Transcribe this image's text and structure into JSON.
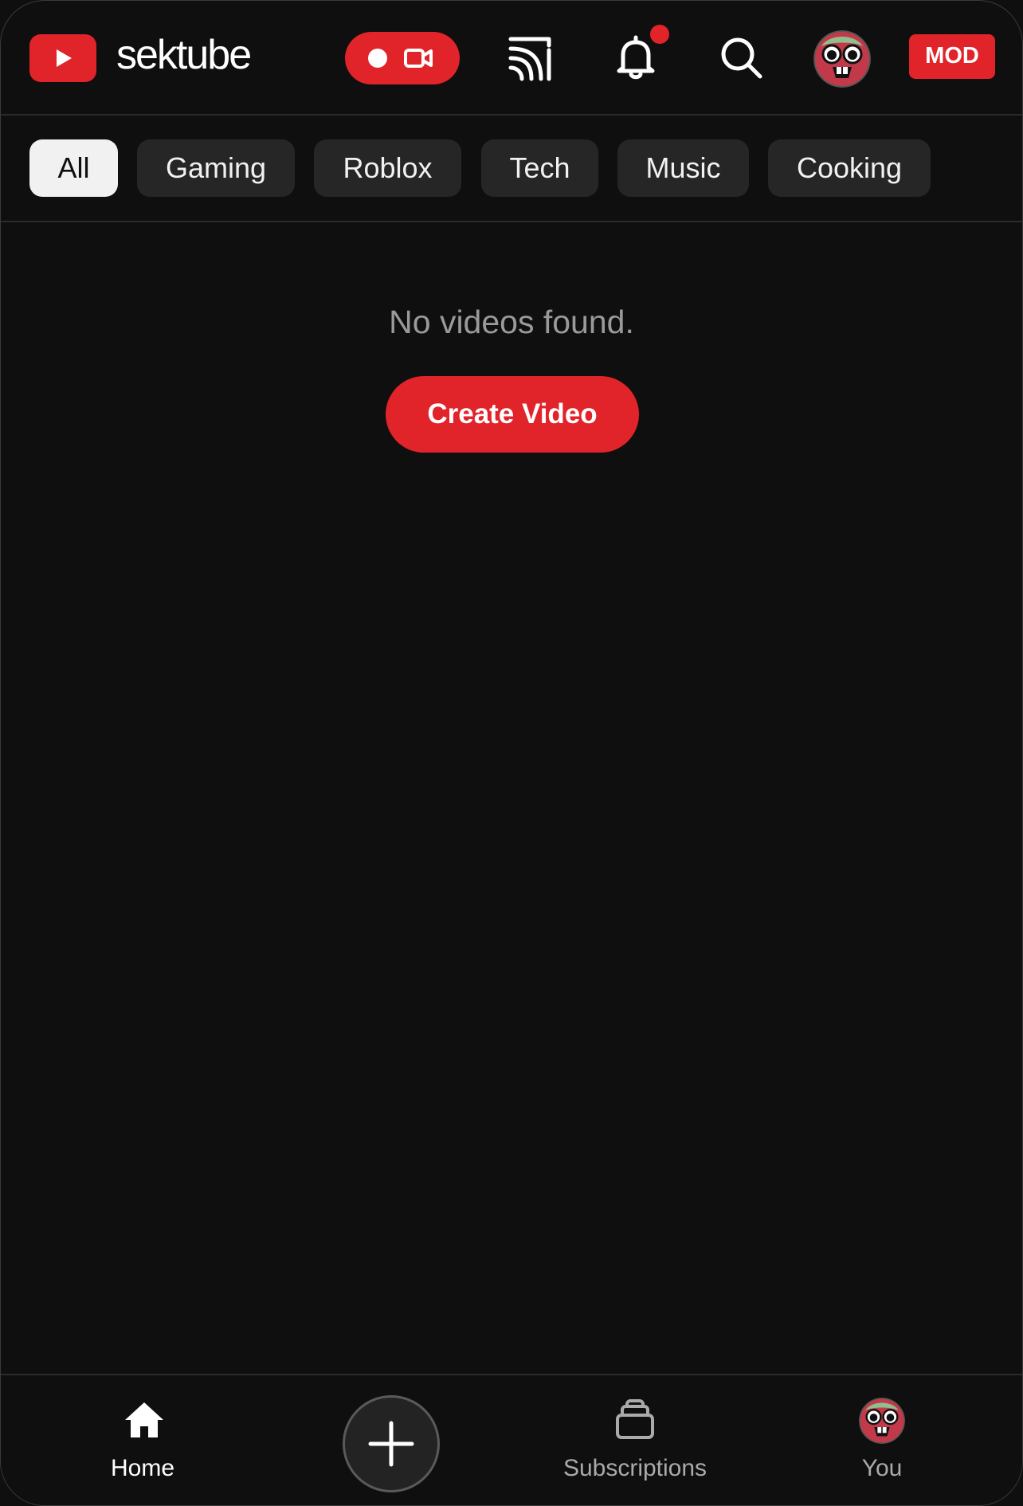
{
  "header": {
    "brand": "sektube",
    "live_icon": "record-camera-icon",
    "cast_icon": "cast-icon",
    "notifications_icon": "bell-icon",
    "search_icon": "search-icon",
    "avatar": "user-avatar",
    "mod_badge": "MOD"
  },
  "chips": [
    {
      "label": "All",
      "selected": true
    },
    {
      "label": "Gaming",
      "selected": false
    },
    {
      "label": "Roblox",
      "selected": false
    },
    {
      "label": "Tech",
      "selected": false
    },
    {
      "label": "Music",
      "selected": false
    },
    {
      "label": "Cooking",
      "selected": false
    }
  ],
  "main": {
    "empty_message": "No videos found.",
    "create_button": "Create Video"
  },
  "bottom_nav": {
    "home": {
      "label": "Home",
      "icon": "home-icon",
      "active": true
    },
    "create": {
      "icon": "plus-icon"
    },
    "subscriptions": {
      "label": "Subscriptions",
      "icon": "subscriptions-icon"
    },
    "you": {
      "label": "You",
      "icon": "avatar"
    }
  },
  "colors": {
    "accent": "#e1232a",
    "background": "#0f0f0f",
    "chip": "#262626",
    "chip_active": "#f1f1f1",
    "muted_text": "#9a9a9a"
  }
}
